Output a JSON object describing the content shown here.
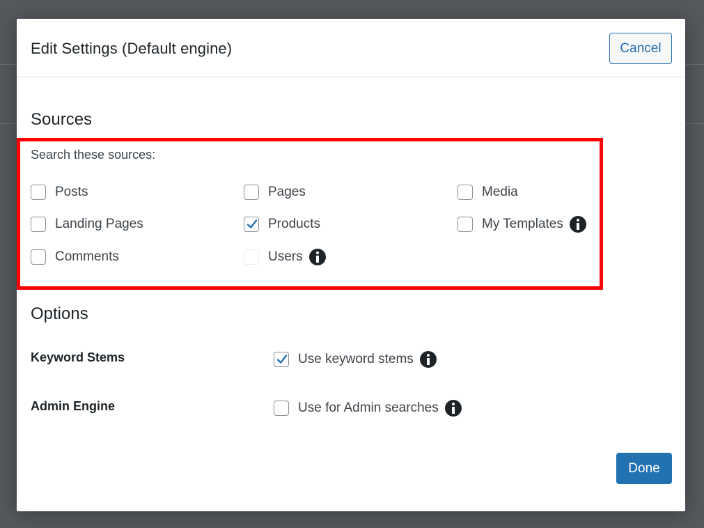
{
  "modal": {
    "title": "Edit Settings (Default engine)",
    "cancel_label": "Cancel",
    "done_label": "Done"
  },
  "sources": {
    "heading": "Sources",
    "prompt": "Search these sources:",
    "items": [
      {
        "label": "Posts",
        "checked": false
      },
      {
        "label": "Pages",
        "checked": false
      },
      {
        "label": "Media",
        "checked": false
      },
      {
        "label": "Landing Pages",
        "checked": false
      },
      {
        "label": "Products",
        "checked": true
      },
      {
        "label": "My Templates",
        "checked": false,
        "info": true
      },
      {
        "label": "Comments",
        "checked": false
      },
      {
        "label": "Users",
        "checked": false,
        "disabled": true,
        "info": true
      }
    ]
  },
  "options": {
    "heading": "Options",
    "keyword_stems": {
      "label": "Keyword Stems",
      "checkbox_label": "Use keyword stems",
      "checked": true
    },
    "admin_engine": {
      "label": "Admin Engine",
      "checkbox_label": "Use for Admin searches",
      "checked": false
    }
  },
  "colors": {
    "accent": "#2271b1",
    "highlight": "#ff0000",
    "backdrop": "#55585d"
  }
}
